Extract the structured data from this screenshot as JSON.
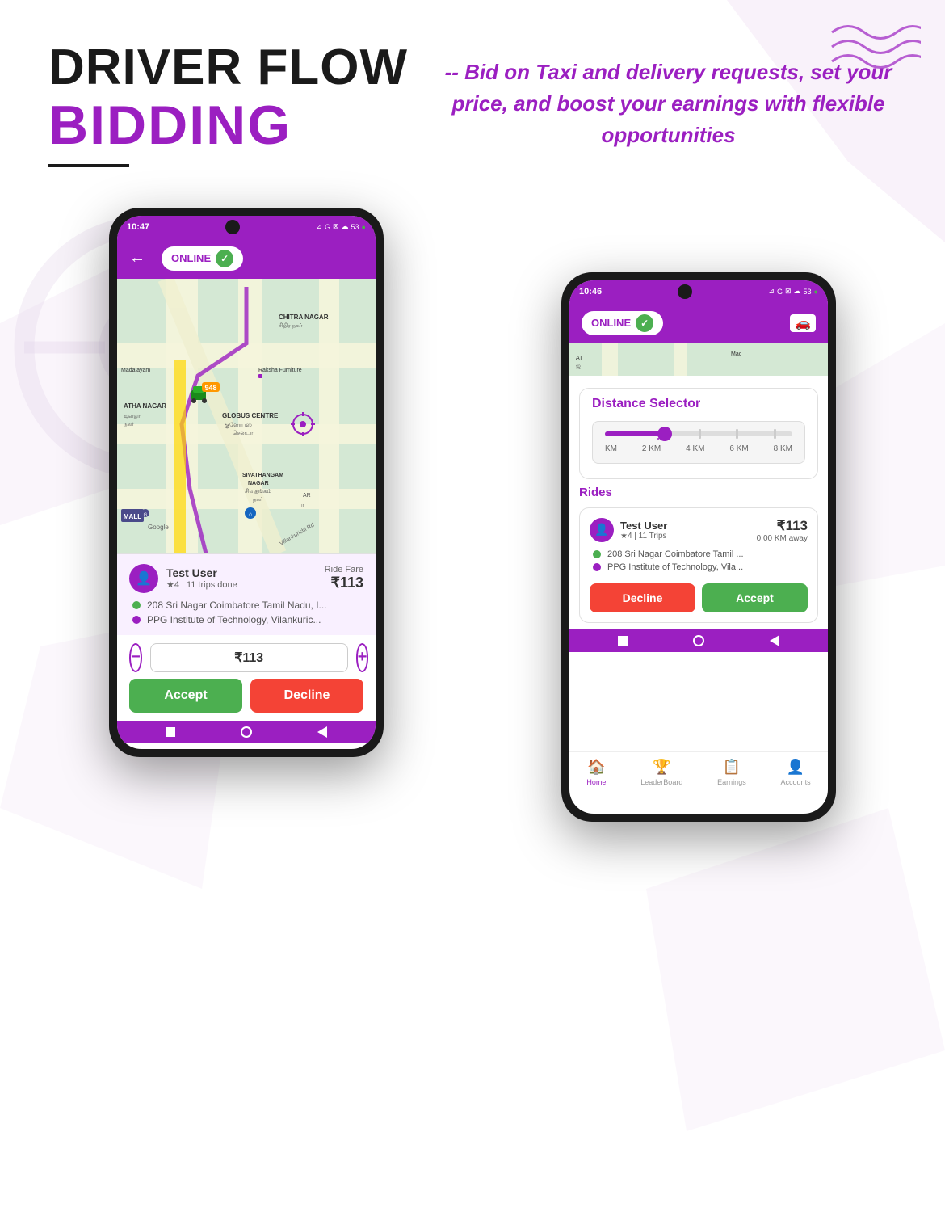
{
  "page": {
    "title": "DRIVER FLOW",
    "subtitle": "BIDDING",
    "underline": true,
    "description": "-- Bid on Taxi and delivery requests, set your price, and boost your earnings with flexible opportunities"
  },
  "phone1": {
    "status_time": "10:47",
    "status_icons": "⊿ G ⊠ ☁ 53",
    "online_label": "ONLINE",
    "back_arrow": "←",
    "map_visible": true,
    "ride_card": {
      "user_name": "Test User",
      "user_rating": "★4  |  11 trips done",
      "fare_label": "Ride Fare",
      "fare_amount": "₹113",
      "pickup": "208 Sri Nagar Coimbatore Tamil Nadu, I...",
      "dropoff": "PPG Institute of Technology, Vilankuric..."
    },
    "bid_value": "₹113",
    "accept_label": "Accept",
    "decline_label": "Decline"
  },
  "phone2": {
    "status_time": "10:46",
    "status_icons": "⊿ G ⊠ ☁ 53",
    "online_label": "ONLINE",
    "distance_selector_title": "Distance Selector",
    "slider_labels": [
      "KM",
      "2 KM",
      "4 KM",
      "6 KM",
      "8 KM"
    ],
    "rides_title": "Rides",
    "ride_card": {
      "user_name": "Test User",
      "user_rating": "★4  |  11 Trips",
      "fare_amount": "₹113",
      "distance": "0.00 KM away",
      "pickup": "208 Sri Nagar Coimbatore Tamil ...",
      "dropoff": "PPG Institute of Technology, Vila..."
    },
    "decline_label": "Decline",
    "accept_label": "Accept",
    "bottom_nav": [
      {
        "icon": "🏠",
        "label": "Home",
        "active": true
      },
      {
        "icon": "🏆",
        "label": "LeaderBoard",
        "active": false
      },
      {
        "icon": "📋",
        "label": "Earnings",
        "active": false
      },
      {
        "icon": "👤",
        "label": "Accounts",
        "active": false
      }
    ]
  },
  "colors": {
    "purple": "#9b1fc1",
    "green": "#4caf50",
    "red": "#f44336",
    "dark": "#1a1a1a"
  }
}
